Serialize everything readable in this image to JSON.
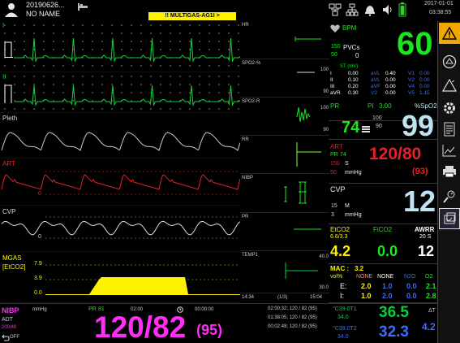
{
  "header": {
    "patient_id": "20190626...",
    "patient_name": "NO NAME",
    "alarm_text": "!! MULTIGAS-AG1I >",
    "date": "2017-01-01",
    "time": "03:38:55"
  },
  "colors": {
    "ecg": "#19d13a",
    "pleth": "#cccccc",
    "art": "#e5202a",
    "cvp": "#dddddd",
    "co2": "#fff200",
    "hr": "#19e61c",
    "spo2": "#bfe3f0",
    "nibp": "#ff2df5",
    "resp": "#8cff3a",
    "temp": "#00d23c",
    "gas": "#fff000"
  },
  "waves": {
    "ecg1_label": "I",
    "ecg2_label": "II",
    "pleth_label": "Pleth",
    "art_label": "ART",
    "art_scale_top": "",
    "art_scale_low": "0",
    "cvp_label": "CVP",
    "cvp_scale_low": "0",
    "gas_label": "MGAS",
    "gas_sublabel": "[EtCO2]",
    "gas_scale_top": "7.9",
    "gas_scale_mid": "3.9",
    "gas_scale_low": "0.0"
  },
  "trends": {
    "hr": {
      "label": "HR"
    },
    "spo2pct": {
      "label": "SPO2-%",
      "scale_top": "100",
      "scale_low": "90"
    },
    "spo2r": {
      "label": "SPO2-R",
      "scale_top": "100",
      "scale_low": "90"
    },
    "rr": {
      "label": "RR",
      "scale_top": "",
      "scale_low": ""
    },
    "nibp": {
      "label": "NIBP",
      "scale_top": "",
      "scale_low": ""
    },
    "pr": {
      "label": "PR",
      "scale_top": "",
      "scale_low": ""
    },
    "temp": {
      "label": "TEMP1",
      "scale_top": "40.0",
      "scale_low": "30.0"
    },
    "time_start": "14:34",
    "page": "(1/3)",
    "time_end": "15:04"
  },
  "hr": {
    "label": "BPM",
    "value": "60",
    "pvc_upper": "150",
    "pvc_lower": "50",
    "pvc_label": "PVCs",
    "pvc_value": "0",
    "st_label": "ST (mV)",
    "st_rows": [
      {
        "lead_a": "I",
        "val_a": "0.00",
        "lead_b": "aVL",
        "val_b": "0.40",
        "lead_c": "V1",
        "val_c": "0.00"
      },
      {
        "lead_a": "II",
        "val_a": "0.10",
        "lead_b": "aVL",
        "val_b": "0.00",
        "lead_c": "V2",
        "val_c": "0.00"
      },
      {
        "lead_a": "III",
        "val_a": "0.20",
        "lead_b": "aVF",
        "val_b": "0.00",
        "lead_c": "V4",
        "val_c": "0.00"
      },
      {
        "lead_a": "aVR",
        "val_a": "0.30",
        "lead_b": "V2",
        "val_b": "0.00",
        "lead_c": "V5",
        "val_c": "1.15"
      }
    ]
  },
  "spo2": {
    "pr_label": "PR",
    "pi_label": "PI",
    "pi_value": "3.00",
    "label": "%SpO2",
    "pr_value": "74",
    "upper": "100",
    "lower": "90",
    "value": "99"
  },
  "art": {
    "label": "ART",
    "pr_label": "PR",
    "pr_value": "74",
    "upper": "150",
    "lower": "50",
    "s_label": "S",
    "unit": "mmHg",
    "value": "120/80",
    "mean": "(93)"
  },
  "cvp": {
    "label": "CVP",
    "upper": "15",
    "lower": "3",
    "m_label": "M",
    "unit": "mmHg",
    "value": "12"
  },
  "gas": {
    "etco2_label": "EtCO2",
    "etco2_range": "6.6/3.3",
    "etco2_value": "4.2",
    "fico2_label": "FiCO2",
    "fico2_value": "0.0",
    "awrr_label": "AWRR",
    "awrr_range": "20 S",
    "awrr_value": "12",
    "mac_label": "MAC :",
    "mac_value": "3.2",
    "unit": "vol%",
    "col_none1": "NONE",
    "col_none2": "NONE",
    "col_n2o": "N2O",
    "col_o2": "O2",
    "e_label": "E:",
    "e_values": [
      "2.0",
      "1.0",
      "0.0",
      "2.1"
    ],
    "i_label": "I:",
    "i_values": [
      "1.0",
      "2.0",
      "0.0",
      "2.8"
    ]
  },
  "nibp": {
    "label": "NIBP",
    "unit": "mmHg",
    "pr_label": "PR",
    "pr_value": "81",
    "interval": "02:00",
    "countdown": "00:00:00",
    "mode": "ADT",
    "limits": "200/40",
    "value": "120/82",
    "mean": "(95)",
    "off_label": "OFF",
    "history": [
      "02:00:32; 120 / 82 (95)",
      "01:38:05; 120 / 82 (95)",
      "00:02:48; 120 / 82 (95)"
    ]
  },
  "temp": {
    "t1_label": "°C39.0T1",
    "t1_sub": "34.0",
    "t2_label": "°C39.0T2",
    "t2_sub": "34.0",
    "t1_value": "36.5",
    "t2_value": "32.3",
    "dt_label": "ΔT",
    "dt_value": "4.2"
  },
  "sidebar": {
    "icons": [
      "alarm-warning-icon",
      "silence-icon",
      "alarm-reset-icon",
      "settings-icon",
      "report-icon",
      "trend-icon",
      "print-icon",
      "nibp-icon",
      "freeze-icon",
      "exit-icon"
    ]
  }
}
